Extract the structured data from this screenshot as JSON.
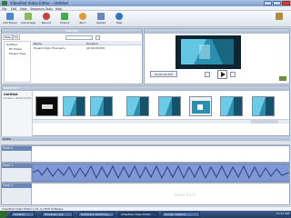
{
  "window": {
    "title": "VideoPad Video Editor - Untitled"
  },
  "menu": [
    "File",
    "Edit",
    "View",
    "Sequence",
    "Tools",
    "Help"
  ],
  "toolbar": [
    {
      "label": "Add File(s)",
      "icon": "add-file-icon",
      "color": "#4f86c6"
    },
    {
      "label": "Add Image",
      "icon": "add-image-icon",
      "color": "#8bb85a"
    },
    {
      "label": "Record",
      "icon": "record-icon",
      "color": "#c24545"
    },
    {
      "label": "Export",
      "icon": "export-icon",
      "color": "#49a84c"
    },
    {
      "label": "Burn",
      "icon": "burn-disc-icon",
      "color": "#e09a3b"
    },
    {
      "label": "Upload",
      "icon": "upload-icon",
      "color": "#6a86c0"
    },
    {
      "label": "Help",
      "icon": "help-icon",
      "color": "#2f74c0"
    }
  ],
  "footage": {
    "header": "Footage",
    "tabs": [
      "Files",
      "FX"
    ],
    "tree": [
      "Untitled",
      "PC Folder",
      "Project Clips"
    ],
    "columns": [
      "Name",
      "Duration"
    ],
    "rows": [
      {
        "name": "Project Clips: final.wmv",
        "duration": "00:00:34.255"
      }
    ]
  },
  "preview": {
    "timecode": "00:00:34.255"
  },
  "sequence": {
    "header": "Sequence",
    "name": "Untitled",
    "info": "Duration: 00:00:34.255"
  },
  "audio": {
    "header": "Audio"
  },
  "tracks": [
    {
      "label": "Track 0"
    },
    {
      "label": "Track 1"
    },
    {
      "label": "Track 2",
      "placeholder": "Audio Track"
    }
  ],
  "status": {
    "text": "VideoPad Video Editor 1.21 (c) NCH Software"
  },
  "taskbar": {
    "items": [
      "Untitled - ...",
      "Windows Live",
      "Hardware Switching ...",
      "VideoPad Video Editor",
      "Screen Capture - ..."
    ],
    "clock": "11:21 AM"
  }
}
